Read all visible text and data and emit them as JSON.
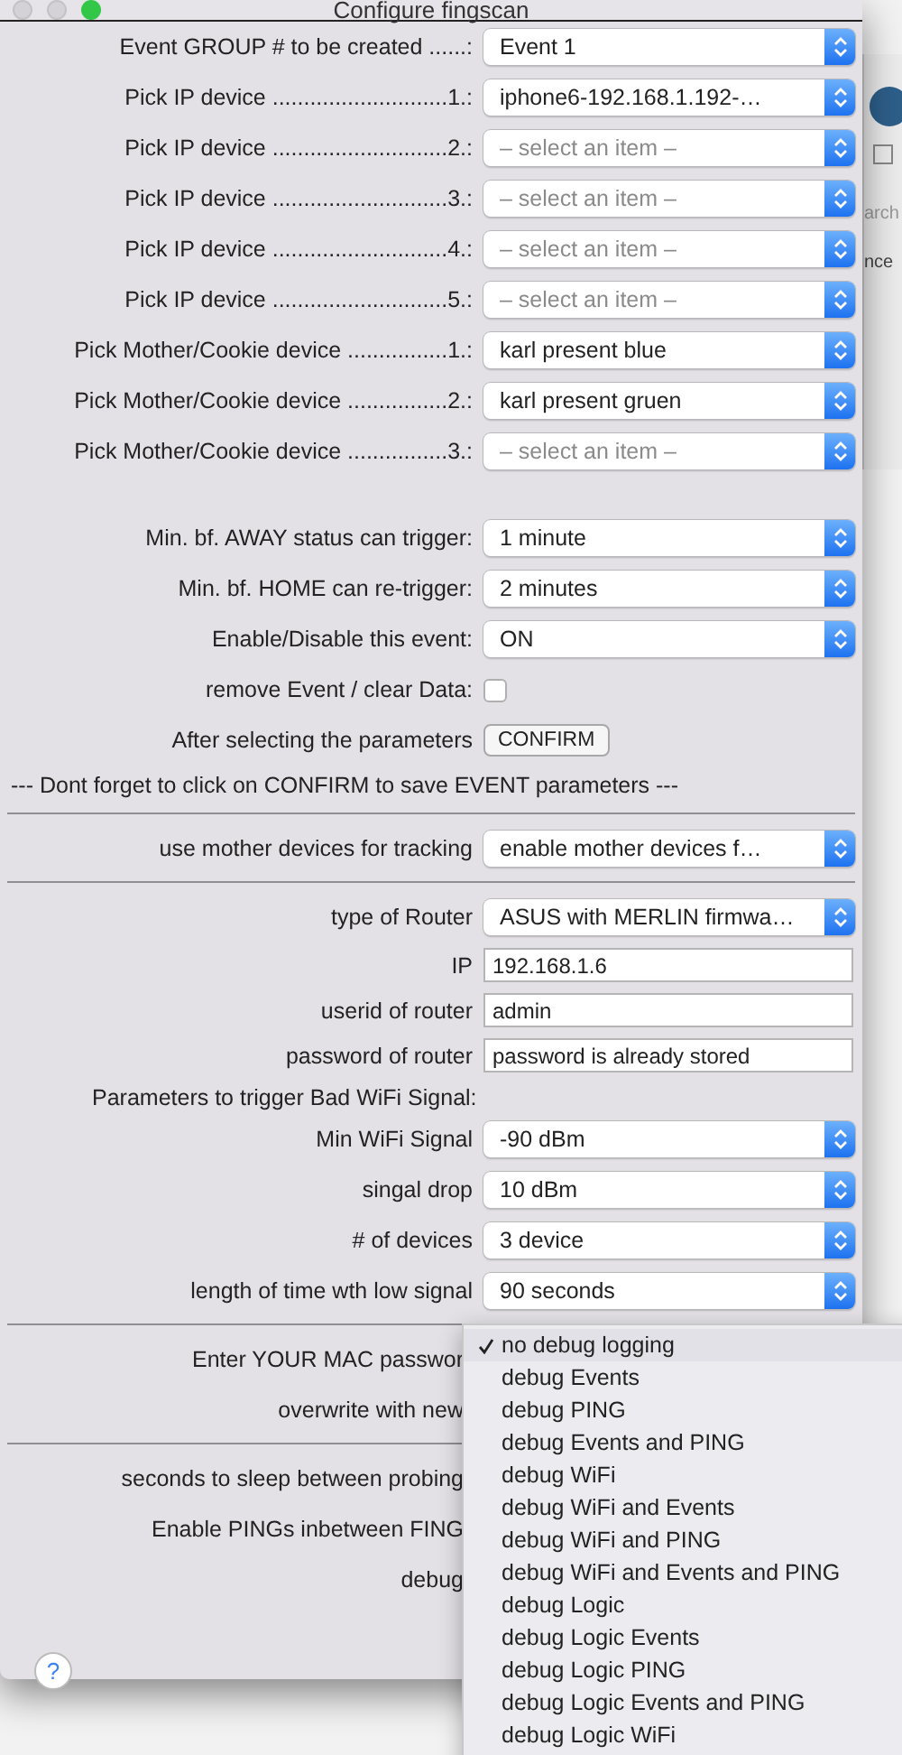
{
  "window": {
    "title": "Configure fingscan"
  },
  "rows": [
    {
      "kind": "select",
      "label": "Event GROUP # to be created ......:",
      "value": "Event 1"
    },
    {
      "kind": "select",
      "label": "Pick IP device ............................1.:",
      "value": "iphone6-192.168.1.192-…"
    },
    {
      "kind": "select",
      "label": "Pick IP device ............................2.:",
      "placeholder": "– select an item –"
    },
    {
      "kind": "select",
      "label": "Pick IP device ............................3.:",
      "placeholder": "– select an item –"
    },
    {
      "kind": "select",
      "label": "Pick IP device ............................4.:",
      "placeholder": "– select an item –"
    },
    {
      "kind": "select",
      "label": "Pick IP device ............................5.:",
      "placeholder": "– select an item –"
    },
    {
      "kind": "select",
      "label": "Pick Mother/Cookie device ................1.:",
      "value": "karl present blue"
    },
    {
      "kind": "select",
      "label": "Pick Mother/Cookie device ................2.:",
      "value": "karl present gruen"
    },
    {
      "kind": "select",
      "label": "Pick Mother/Cookie device ................3.:",
      "placeholder": "– select an item –"
    },
    {
      "kind": "gap"
    },
    {
      "kind": "select",
      "label": "Min. bf. AWAY status can trigger:",
      "value": "1 minute"
    },
    {
      "kind": "select",
      "label": "Min. bf. HOME can re-trigger:",
      "value": "2 minutes"
    },
    {
      "kind": "select",
      "label": "Enable/Disable this event:",
      "value": "ON"
    },
    {
      "kind": "checkbox",
      "label": "remove Event / clear Data:",
      "checked": false
    },
    {
      "kind": "button",
      "label": "After selecting the parameters",
      "button": "CONFIRM"
    },
    {
      "kind": "note",
      "text": "---  Dont forget to click on CONFIRM to save EVENT parameters  ---"
    },
    {
      "kind": "separator"
    },
    {
      "kind": "select",
      "label": "use mother devices for tracking",
      "value": "enable   mother devices f…"
    },
    {
      "kind": "separator"
    },
    {
      "kind": "select",
      "label": "type of Router",
      "value": "ASUS with MERLIN firmwa…"
    },
    {
      "kind": "text",
      "label": "IP",
      "value": "192.168.1.6"
    },
    {
      "kind": "text",
      "label": "userid of router",
      "value": "admin"
    },
    {
      "kind": "text",
      "label": "password of router",
      "value": "password is already stored"
    },
    {
      "kind": "heading",
      "text": "Parameters to trigger Bad WiFi Signal:"
    },
    {
      "kind": "select",
      "label": "Min WiFi Signal",
      "value": "-90 dBm"
    },
    {
      "kind": "select",
      "label": "singal drop",
      "value": "10 dBm"
    },
    {
      "kind": "select",
      "label": "# of devices",
      "value": "3 device"
    },
    {
      "kind": "select",
      "label": "length of time wth low signal",
      "value": "90 seconds"
    },
    {
      "kind": "separator"
    },
    {
      "kind": "covered",
      "label": "Enter YOUR MAC passwor"
    },
    {
      "kind": "covered",
      "label": "overwrite with new"
    },
    {
      "kind": "separator"
    },
    {
      "kind": "covered",
      "label": "seconds to sleep between probing"
    },
    {
      "kind": "covered",
      "label": "Enable PINGs inbetween FING"
    },
    {
      "kind": "covered",
      "label": "debug"
    }
  ],
  "popup": [
    {
      "label": "no debug logging",
      "selected": true
    },
    {
      "label": "debug Events",
      "selected": false
    },
    {
      "label": "debug PING",
      "selected": false
    },
    {
      "label": "debug Events and PING",
      "selected": false
    },
    {
      "label": "debug WiFi",
      "selected": false
    },
    {
      "label": "debug WiFi and Events",
      "selected": false
    },
    {
      "label": "debug WiFi and PING",
      "selected": false
    },
    {
      "label": "debug WiFi and Events and PING",
      "selected": false
    },
    {
      "label": "debug Logic",
      "selected": false
    },
    {
      "label": "debug Logic Events",
      "selected": false
    },
    {
      "label": "debug Logic PING",
      "selected": false
    },
    {
      "label": "debug Logic Events and PING",
      "selected": false
    },
    {
      "label": "debug Logic WiFi",
      "selected": false
    }
  ],
  "help_button": "?",
  "background_window": {
    "texts": [
      "arch",
      "nce"
    ]
  }
}
